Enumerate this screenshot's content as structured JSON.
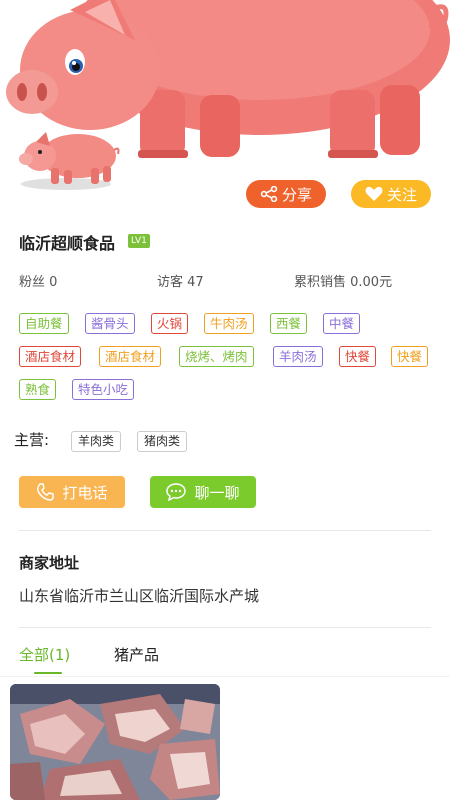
{
  "header": {
    "share_label": "分享",
    "follow_label": "关注"
  },
  "shop": {
    "name": "临沂超顺食品",
    "level": "LV1",
    "fans": "粉丝 0",
    "visitors": "访客 47",
    "sales": "累积销售 0.00元"
  },
  "tags": [
    {
      "label": "自助餐",
      "color": "#7cc13a"
    },
    {
      "label": "酱骨头",
      "color": "#8a6fd8"
    },
    {
      "label": "火锅",
      "color": "#e0483a"
    },
    {
      "label": "牛肉汤",
      "color": "#f0a020"
    },
    {
      "label": "西餐",
      "color": "#7cc13a"
    },
    {
      "label": "中餐",
      "color": "#8a6fd8"
    },
    {
      "label": "酒店食材",
      "color": "#e0483a"
    },
    {
      "label": "酒店食材",
      "color": "#f0a020"
    },
    {
      "label": "烧烤、烤肉",
      "color": "#7cc13a"
    },
    {
      "label": "羊肉汤",
      "color": "#8a6fd8"
    },
    {
      "label": "快餐",
      "color": "#e0483a"
    },
    {
      "label": "快餐",
      "color": "#f0a020"
    },
    {
      "label": "熟食",
      "color": "#7cc13a"
    },
    {
      "label": "特色小吃",
      "color": "#8a6fd8"
    }
  ],
  "main_business": {
    "label": "主营:",
    "items": [
      "羊肉类",
      "猪肉类"
    ]
  },
  "actions": {
    "call_label": "打电话",
    "chat_label": "聊一聊"
  },
  "address": {
    "title": "商家地址",
    "text": "山东省临沂市兰山区临沂国际水产城"
  },
  "product_tabs": [
    {
      "label": "全部(1)",
      "active": true
    },
    {
      "label": "猪产品",
      "active": false
    }
  ],
  "colors": {
    "share": "#f0622c",
    "follow": "#fbb926",
    "call": "#f8b551",
    "chat": "#7ccb2c",
    "accent": "#68b82a"
  }
}
